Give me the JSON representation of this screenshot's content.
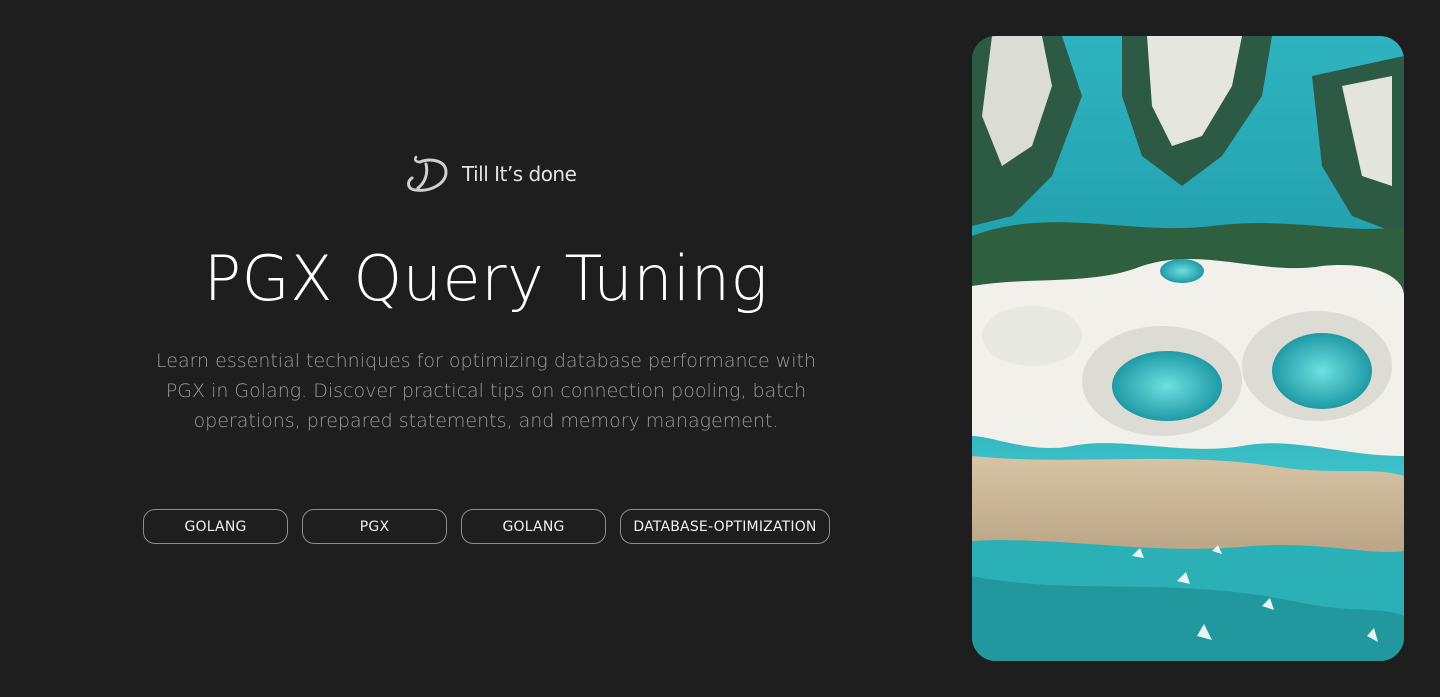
{
  "brand": {
    "name": "Till It’s done",
    "logo_icon": "cursive-d-logo-icon"
  },
  "article": {
    "title": "PGX Query Tuning",
    "description": "Learn essential techniques for optimizing database performance with PGX in Golang. Discover practical tips on connection pooling, batch operations, prepared statements, and memory management."
  },
  "tags": [
    {
      "label": "GOLANG"
    },
    {
      "label": "PGX"
    },
    {
      "label": "GOLANG"
    },
    {
      "label": "DATABASE-OPTIMIZATION"
    }
  ],
  "colors": {
    "background": "#1e1e1e",
    "title": "#ffffff",
    "description": "#9b9b9b",
    "tag_border": "#8e8e8e"
  }
}
